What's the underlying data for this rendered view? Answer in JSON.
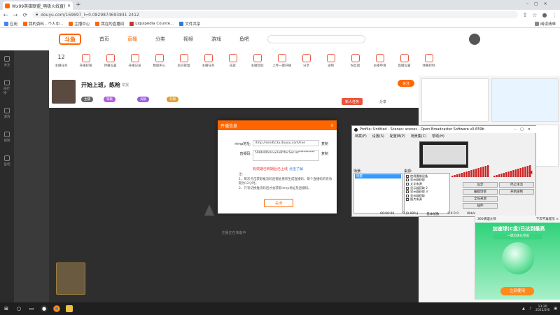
{
  "browser": {
    "tab_title": "Wx99英雄联盟_萌极火线直播_斗鱼",
    "url": "douyu.com/169697_l=0.0829874693841 2412",
    "bookmarks": [
      "应用",
      "我的资料 - 个人中...",
      "主播中心",
      "我在的直播间",
      "Liquipedia Counte...",
      "文件共享"
    ],
    "bookmark_right": "阅读清单"
  },
  "site": {
    "logo": "斗鱼",
    "nav": [
      "首页",
      "直播",
      "分类",
      "视频",
      "游戏",
      "鱼吧"
    ],
    "active_nav": "直播",
    "rail": [
      "关注",
      "排行榜",
      "游戏",
      "视频",
      "鱼吧"
    ]
  },
  "categories": [
    {
      "num": "12",
      "label": "主播任务"
    },
    {
      "num": "",
      "label": "开播权限"
    },
    {
      "num": "",
      "label": "弹幕设置"
    },
    {
      "num": "",
      "label": "开播记录"
    },
    {
      "num": "",
      "label": "数据中心"
    },
    {
      "num": "",
      "label": "房间管理"
    },
    {
      "num": "",
      "label": "主播任务"
    },
    {
      "num": "",
      "label": "成就"
    },
    {
      "num": "",
      "label": "主播帮助"
    },
    {
      "num": "",
      "label": "上传一键开播"
    },
    {
      "num": "",
      "label": "分享"
    },
    {
      "num": "",
      "label": "录制"
    },
    {
      "num": "",
      "label": "粉丝团"
    },
    {
      "num": "",
      "label": "主播申请"
    },
    {
      "num": "",
      "label": "直播设置"
    },
    {
      "num": "",
      "label": "弹幕控制"
    }
  ],
  "room": {
    "title": "开始上班，练枪",
    "report": "举报",
    "follow": "关注",
    "task": "新人任务",
    "share": "分享",
    "badges": [
      "主播",
      "等级",
      "贡献",
      "礼物"
    ],
    "player_prompt": "主播正在准备中"
  },
  "push_dialog": {
    "title": "开播信息",
    "rtmp_label": "rtmp地址:",
    "rtmp_value": "rtmp://sendtc3a.douyu.com/live",
    "code_label": "直播码:",
    "code_value": "5986406rHvx2eBYfecSecret**********",
    "copy": "复制",
    "warn": "有效期已到期后已上线",
    "reset": "点击了解",
    "note_title": "注:",
    "notes": [
      "1、每次点击获取推流码后都会重新生成直播码，每个直播码的有效期为12小时。",
      "2、只有切换推流码后才会获取rtmp地址及直播码。"
    ],
    "close": "关闭"
  },
  "obs": {
    "title": "Profile: Untitled - Scenes: scenes - Open Broadcaster Software v0.659b",
    "menu": [
      "档案(F)",
      "设置(S)",
      "配置档(P)",
      "场景集(C)",
      "帮助(H)"
    ],
    "scenes_label": "场景:",
    "scene_item": "场景",
    "sources_label": "来源:",
    "sources": [
      "使用摄像设备",
      "显示器获取",
      "文字来源",
      "显示器获取 2",
      "显示器获取 3",
      "显示器获取",
      "图片来源"
    ],
    "buttons": [
      "设定",
      "编辑场景",
      "全局来源",
      "插件"
    ],
    "buttons_r": [
      "停止串流",
      "开始录制",
      "",
      ""
    ],
    "status": [
      "00:00:00",
      "0 (0.00%)",
      "0kb/s",
      "基本帧数",
      "0 0 0 0"
    ]
  },
  "popup360": {
    "title": "360清理大师",
    "close": "下次不再提示 ×",
    "headline": "加速球(C盘)已达到最高",
    "sub": "一键加速已完成",
    "button": "立刻使用"
  },
  "taskbar": {
    "time": "13:20",
    "date": "2022/2/6",
    "apps": [
      "search",
      "taskview",
      "obs",
      "chrome",
      "files"
    ]
  },
  "colors": {
    "accent": "#ff6600",
    "green": "#2fd27a"
  }
}
